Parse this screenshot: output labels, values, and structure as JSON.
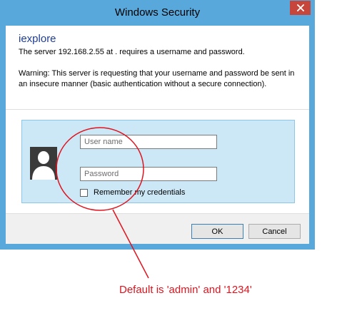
{
  "window": {
    "title": "Windows Security",
    "close_icon": "close-icon"
  },
  "dialog": {
    "app_name": "iexplore",
    "message": "The server 192.168.2.55 at . requires a username and password.",
    "warning": "Warning: This server is requesting that your username and password be sent in an insecure manner (basic authentication without a secure connection)."
  },
  "credentials": {
    "avatar_icon": "user-avatar-icon",
    "username_placeholder": "User name",
    "username_value": "",
    "password_placeholder": "Password",
    "password_value": "",
    "remember_label": "Remember my credentials",
    "remember_checked": false
  },
  "buttons": {
    "ok_label": "OK",
    "cancel_label": "Cancel"
  },
  "annotation": {
    "text": "Default is 'admin' and '1234'",
    "color": "#e0141e"
  },
  "colors": {
    "window_frame": "#58a8dc",
    "close_button": "#c7463b",
    "credential_tile": "#cce8f7",
    "app_name": "#1e3d9a"
  }
}
